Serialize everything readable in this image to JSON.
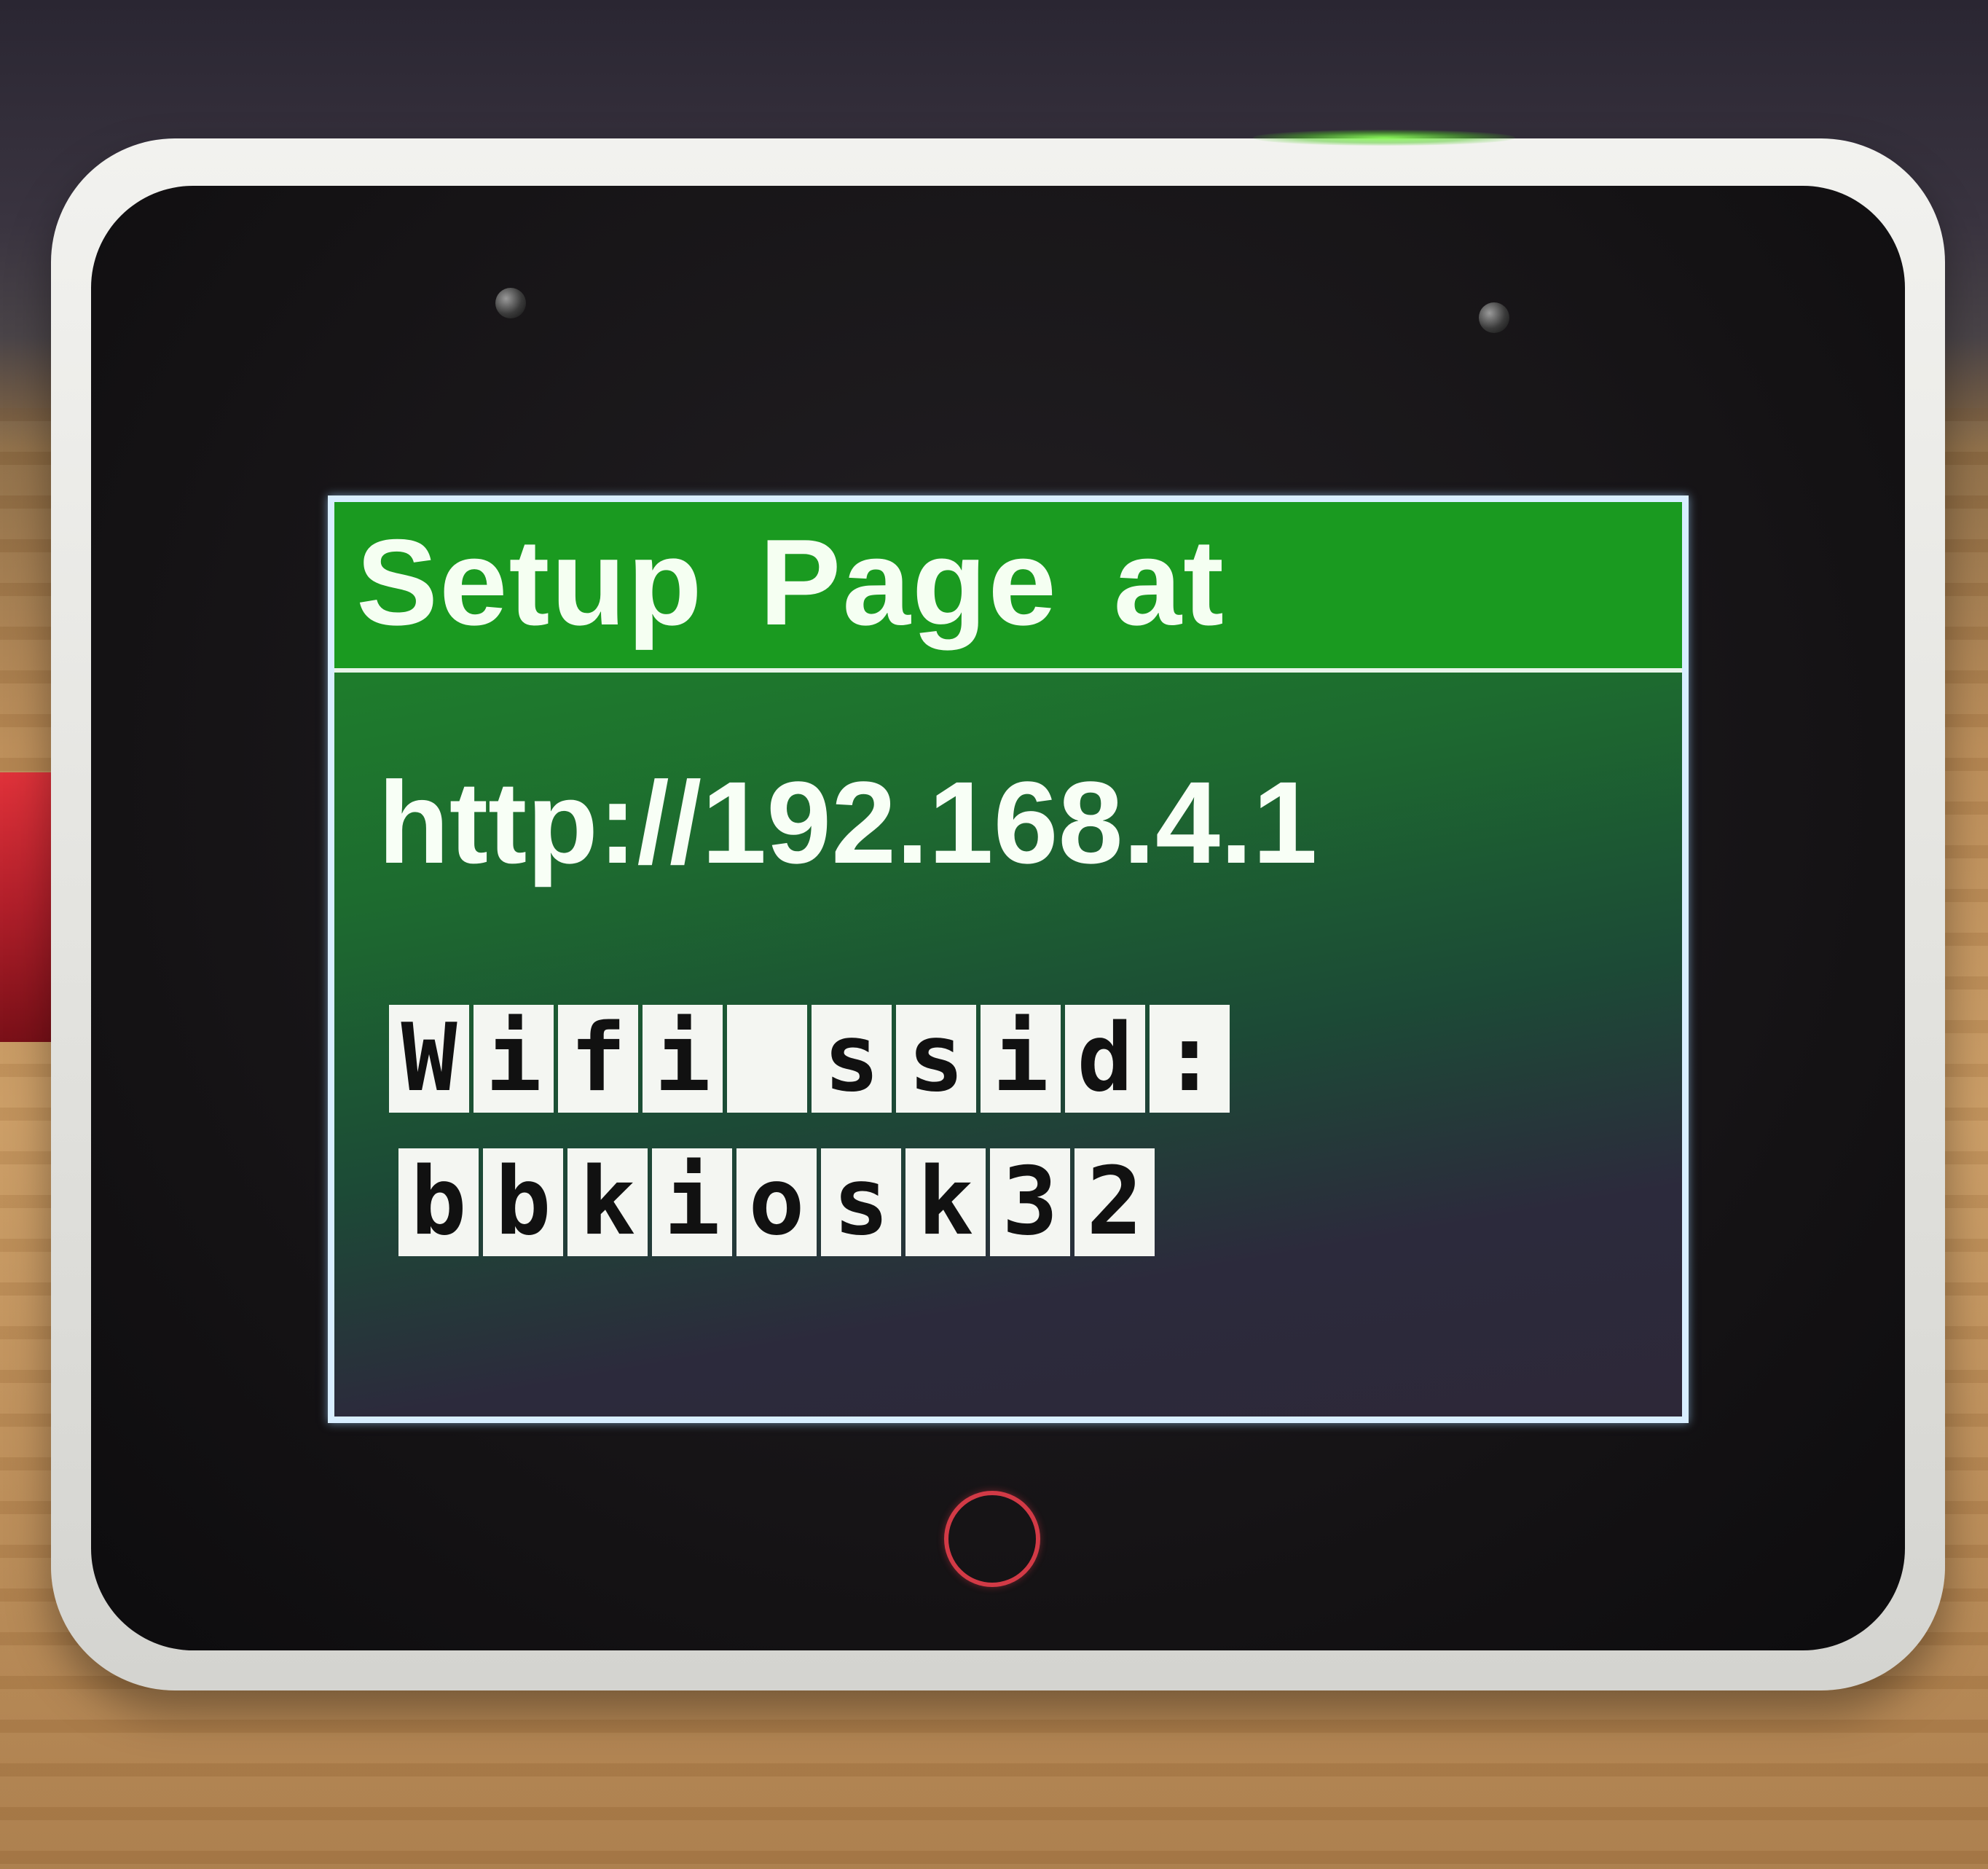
{
  "device": {
    "screen": {
      "header_title": "Setup Page at",
      "url": "http://192.168.4.1",
      "wifi_label": "Wifi ssid:",
      "wifi_ssid": "bbkiosk32"
    },
    "colors": {
      "header_green": "#1a9a20",
      "screen_text": "#f5fff2",
      "label_background": "#f4f6f2",
      "shell": "#e4e4e0",
      "home_button_ring": "#d23a46",
      "status_led": "#8cff5a"
    },
    "icons": [
      "home-button-icon",
      "status-led",
      "sensor-dot"
    ]
  }
}
